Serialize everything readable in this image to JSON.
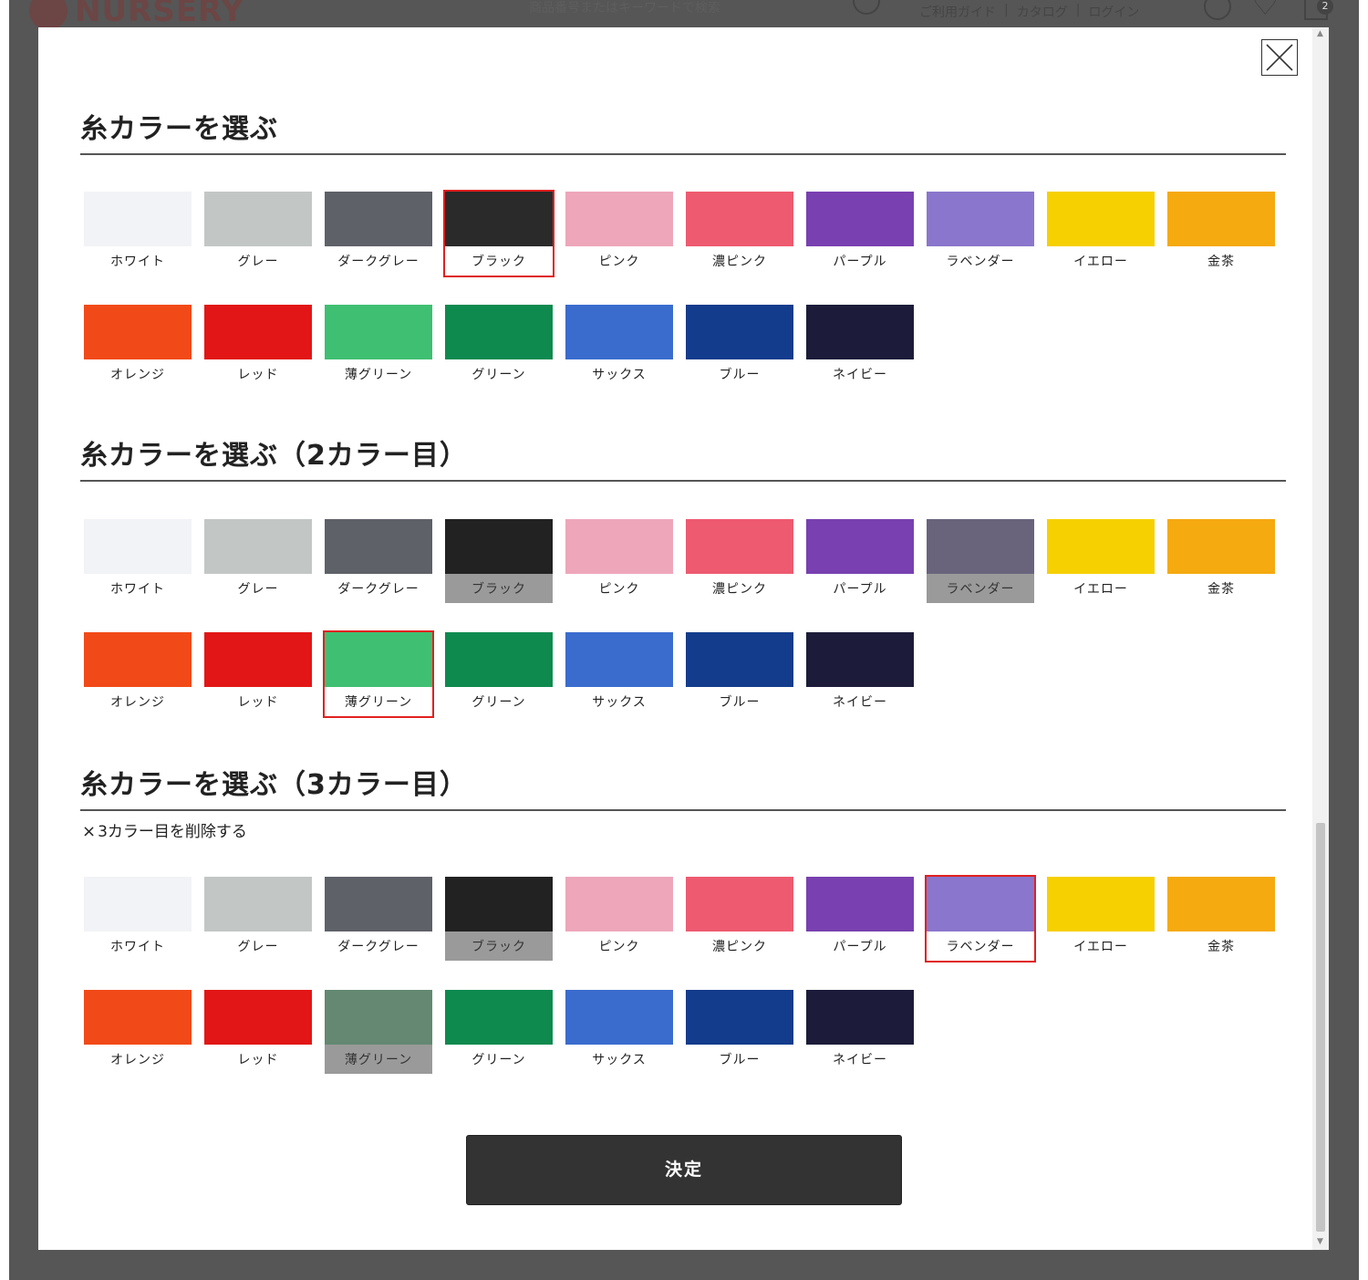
{
  "site": {
    "logo_text": "NURSERY",
    "search_placeholder": "商品番号またはキーワードで検索",
    "nav": [
      "ご利用ガイド",
      "|",
      "カタログ",
      "|",
      "ログイン"
    ],
    "cart_count": "2"
  },
  "modal": {
    "sections": [
      {
        "title": "糸カラーを選ぶ",
        "selected": "ブラック",
        "disabled": []
      },
      {
        "title": "糸カラーを選ぶ（2カラー目）",
        "selected": "薄グリーン",
        "disabled": [
          "ブラック",
          "ラベンダー"
        ]
      },
      {
        "title": "糸カラーを選ぶ（3カラー目）",
        "delete_label": "3カラー目を削除する",
        "selected": "ラベンダー",
        "disabled": [
          "ブラック",
          "薄グリーン"
        ]
      }
    ],
    "confirm_label": "決定"
  },
  "colors": [
    {
      "label": "ホワイト",
      "hex": "#f1f3f6"
    },
    {
      "label": "グレー",
      "hex": "#c2c6c4"
    },
    {
      "label": "ダークグレー",
      "hex": "#5f6169"
    },
    {
      "label": "ブラック",
      "hex": "#2a2a2a"
    },
    {
      "label": "ピンク",
      "hex": "#eea6bb"
    },
    {
      "label": "濃ピンク",
      "hex": "#ee5a70"
    },
    {
      "label": "パープル",
      "hex": "#7840b0"
    },
    {
      "label": "ラベンダー",
      "hex": "#8a76cc"
    },
    {
      "label": "イエロー",
      "hex": "#f6d000"
    },
    {
      "label": "金茶",
      "hex": "#f5aa10"
    },
    {
      "label": "オレンジ",
      "hex": "#f14a18"
    },
    {
      "label": "レッド",
      "hex": "#e21616"
    },
    {
      "label": "薄グリーン",
      "hex": "#3fbf72"
    },
    {
      "label": "グリーン",
      "hex": "#0e8a4f"
    },
    {
      "label": "サックス",
      "hex": "#3a6cce"
    },
    {
      "label": "ブルー",
      "hex": "#133c8c"
    },
    {
      "label": "ネイビー",
      "hex": "#1c1c3a"
    }
  ]
}
